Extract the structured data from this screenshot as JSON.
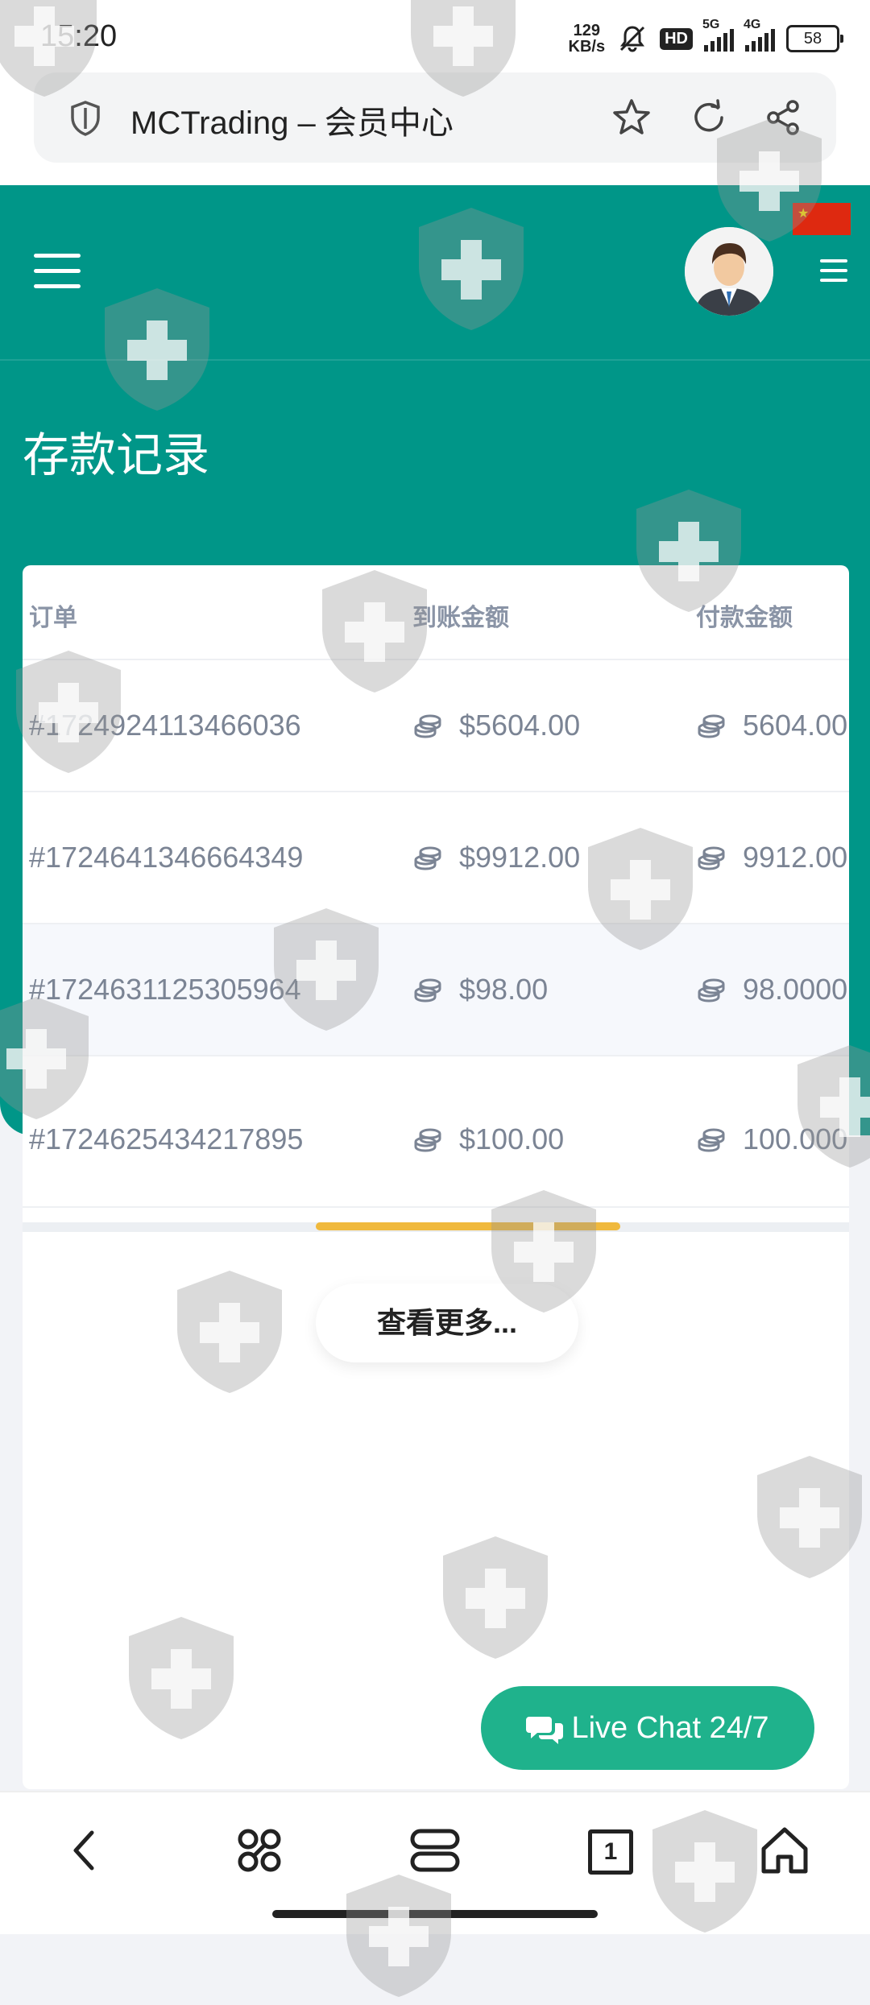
{
  "status_bar": {
    "time": "15:20",
    "net_speed_value": "129",
    "net_speed_unit": "KB/s",
    "hd_badge": "HD",
    "network_1": "5G",
    "network_2": "4G",
    "battery": "58"
  },
  "browser": {
    "url_title": "MCTrading – 会员中心",
    "icons": [
      "shield-icon",
      "star-icon",
      "refresh-icon",
      "share-icon"
    ]
  },
  "header": {
    "page_title": "存款记录",
    "flag": "china-flag"
  },
  "table": {
    "columns": [
      "订单",
      "到账金额",
      "付款金额"
    ],
    "rows": [
      {
        "order": "#1724924113466036",
        "received": "$5604.00",
        "paid": "5604.00"
      },
      {
        "order": "#1724641346664349",
        "received": "$9912.00",
        "paid": "9912.00"
      },
      {
        "order": "#1724631125305964",
        "received": "$98.00",
        "paid": "98.0000"
      },
      {
        "order": "#1724625434217895",
        "received": "$100.00",
        "paid": "100.000"
      }
    ]
  },
  "more_button": "查看更多...",
  "live_chat": "Live Chat 24/7",
  "bottom_nav": {
    "tab_count": "1",
    "icons": [
      "back-icon",
      "apps-icon",
      "menu-icon",
      "tabs-icon",
      "home-icon"
    ]
  },
  "colors": {
    "header_teal": "#009688",
    "live_chat_green": "#1fb28c",
    "scroll_thumb": "#f0b93d"
  }
}
